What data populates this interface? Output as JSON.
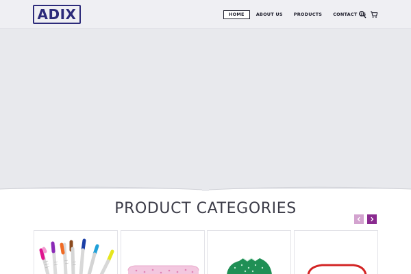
{
  "brand": {
    "logo_text": "ADIX"
  },
  "nav": {
    "items": [
      {
        "label": "HOME",
        "active": true
      },
      {
        "label": "ABOUT US",
        "active": false
      },
      {
        "label": "PRODUCTS",
        "active": false
      },
      {
        "label": "CONTACT US",
        "active": false
      }
    ],
    "icons": [
      "search-icon",
      "cart-icon"
    ]
  },
  "categories": {
    "title": "PRODUCT CATEGORIES",
    "carousel_icons": [
      "chevron-left-icon",
      "chevron-right-icon"
    ],
    "cards": [
      {
        "image": "marker-pens-image"
      },
      {
        "image": "pink-case-image"
      },
      {
        "image": "green-item-image"
      },
      {
        "image": "red-item-image"
      }
    ]
  },
  "colors": {
    "brand": "#2c2a7a",
    "hero_bg": "#e8e9ed",
    "header_bg": "#efeff3",
    "arrow_prev": "#d3a3cf",
    "arrow_next": "#8a2a8f"
  }
}
